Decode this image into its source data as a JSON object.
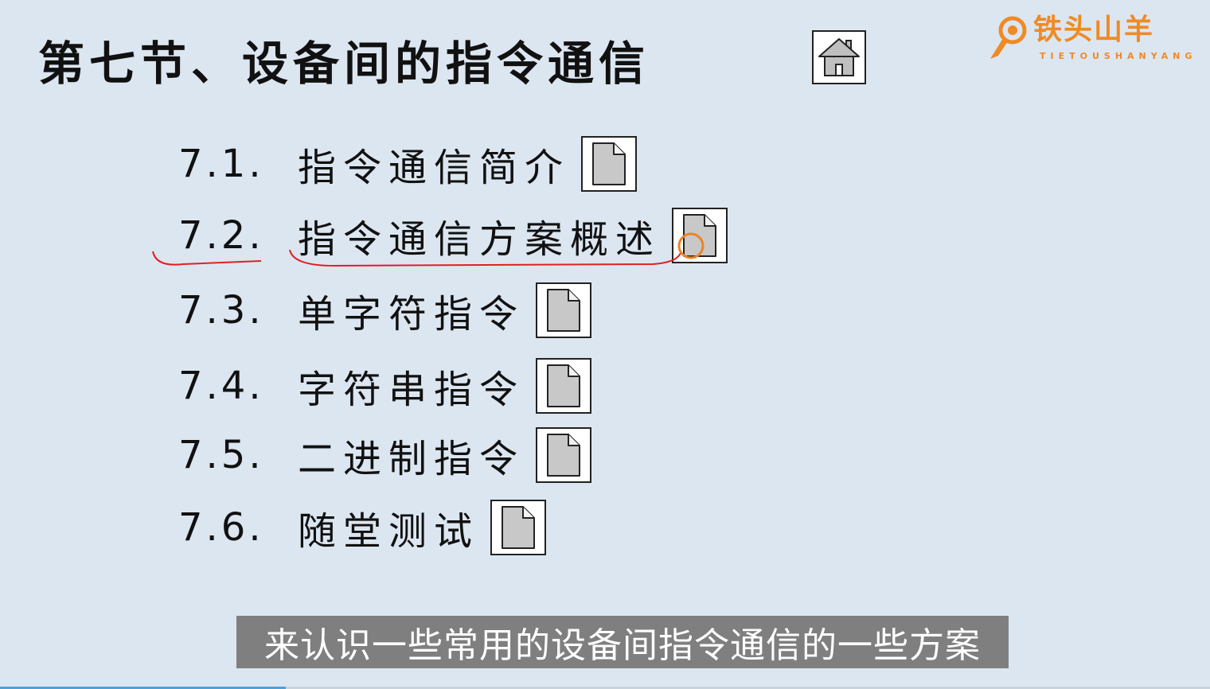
{
  "title": "第七节、设备间的指令通信",
  "logo": {
    "name": "铁头山羊",
    "sub": "TIETOUSHANYANG"
  },
  "toc": [
    {
      "num": "7.1.",
      "label": "指令通信简介"
    },
    {
      "num": "7.2.",
      "label": "指令通信方案概述"
    },
    {
      "num": "7.3.",
      "label": "单字符指令"
    },
    {
      "num": "7.4.",
      "label": "字符串指令"
    },
    {
      "num": "7.5.",
      "label": "二进制指令"
    },
    {
      "num": "7.6.",
      "label": "随堂测试"
    }
  ],
  "subtitle": "来认识一些常用的设备间指令通信的一些方案",
  "progress_fraction": 0.236,
  "colors": {
    "background": "#dce6f1",
    "accent": "#f08a24",
    "annotation": "#e02020"
  },
  "icons": {
    "home": "home-icon",
    "item": "document-icon"
  }
}
